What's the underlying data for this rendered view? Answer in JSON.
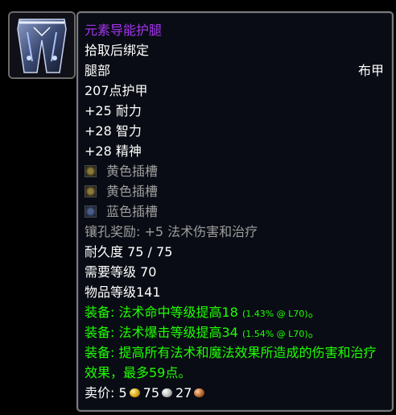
{
  "item": {
    "name": "元素导能护腿",
    "binding": "拾取后绑定",
    "slot": "腿部",
    "armor_type": "布甲",
    "armor": "207点护甲",
    "stats": [
      "+25 耐力",
      "+28 智力",
      "+28 精神"
    ],
    "sockets": [
      {
        "color": "yellow",
        "label": "黄色插槽"
      },
      {
        "color": "yellow",
        "label": "黄色插槽"
      },
      {
        "color": "blue",
        "label": "蓝色插槽"
      }
    ],
    "socket_bonus": "镶孔奖励: +5 法术伤害和治疗",
    "durability": "耐久度 75 / 75",
    "required_level": "需要等级 70",
    "item_level": "物品等级141",
    "equip_effects": [
      {
        "prefix": "装备: ",
        "text": "法术命中等级提高18",
        "note": "(1.43% @ L70)",
        "suffix": "。"
      },
      {
        "prefix": "装备: ",
        "text": "法术爆击等级提高34",
        "note": "(1.54% @ L70)",
        "suffix": "。"
      },
      {
        "prefix": "装备: ",
        "text": "提高所有法术和魔法效果所造成的伤害和治疗效果，最多59点。",
        "note": "",
        "suffix": ""
      }
    ],
    "sell_price": {
      "label": "卖价: ",
      "gold": "5",
      "silver": "75",
      "copper": "27"
    },
    "icon": "cloth-leggings-icon"
  },
  "colors": {
    "epic": "#a335ee",
    "equip": "#1eff00",
    "socket_text": "#9d9d9d",
    "background": "#090c14",
    "border": "#7b7b7b"
  }
}
